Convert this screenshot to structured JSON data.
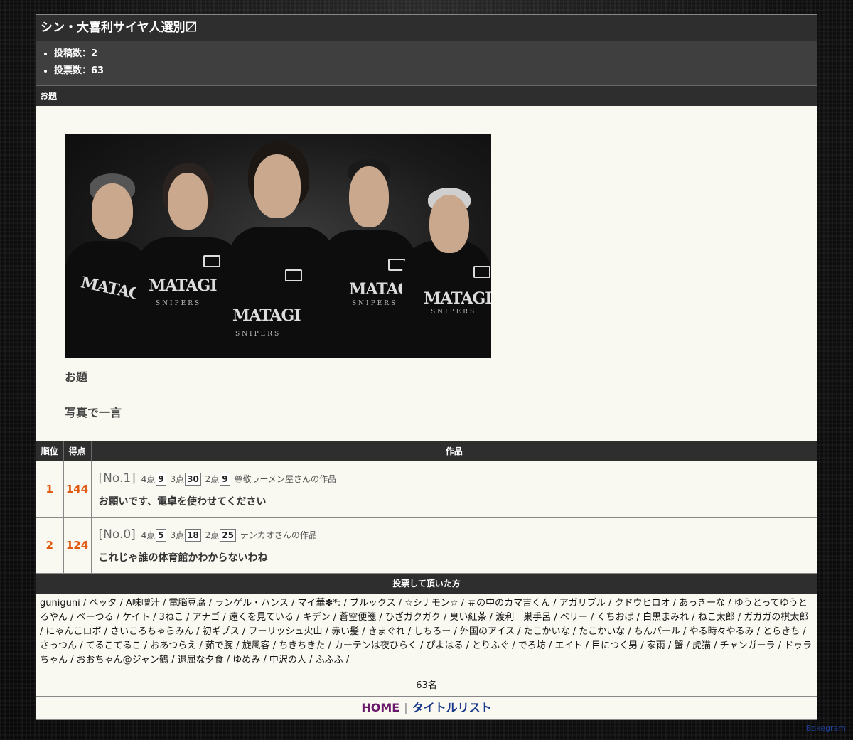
{
  "page": {
    "title": "シン・大喜利サイヤ人選別〼",
    "stats": [
      "投稿数：2",
      "投票数：63"
    ]
  },
  "odai_section": {
    "header": "お題",
    "label": "お題",
    "text": "写真で一言",
    "photo_shirt_text": "MATAGI",
    "photo_shirt_sub": "SNIPERS"
  },
  "results": {
    "headers": {
      "rank": "順位",
      "score": "得点",
      "work": "作品"
    },
    "rows": [
      {
        "rank": "1",
        "score": "144",
        "no": "[No.1]",
        "p4_label": "4点",
        "p4": "9",
        "p3_label": "3点",
        "p3": "30",
        "p2_label": "2点",
        "p2": "9",
        "author": "尊敬ラーメン屋さんの作品",
        "text": "お願いです、電卓を使わせてください"
      },
      {
        "rank": "2",
        "score": "124",
        "no": "[No.0]",
        "p4_label": "4点",
        "p4": "5",
        "p3_label": "3点",
        "p3": "18",
        "p2_label": "2点",
        "p2": "25",
        "author": "テンカオさんの作品",
        "text": "これじゃ誰の体育館かわからないわね"
      }
    ]
  },
  "voters": {
    "header": "投票して頂いた方",
    "list": "guniguni / ペッタ / A味噌汁 / 電脳豆腐 / ランゲル・ハンス / マイ華✽*: / ブルックス / ☆シナモン☆ / ＃の中のカマ吉くん / アガリブル / クドウヒロオ / あっきーな / ゆうとってゆうとるやん / ベーつる / ケイト / 3ねこ / アナゴ / 遠くを見ている / キデン / 蒼空便箋 / ひざガクガク / 臭い紅茶 / 渡利　巣手呂 / ベリー / くちおば / 白黒まみれ / ねこ太郎 / ガガガの棋太郎 / にゃんこロボ / さいころちゃらみん / 初ギプス / フーリッシュ火山 / 赤い髪 / きまぐれ / しちろー / 外国のアイス / たこかいな / たこかいな / ちんパール / やる時々やるみ / とらきち / さっつん / てるこてるこ / おあつらえ / 茹で腕 / 旋風客 / ちきちきた / カーテンは夜ひらく / ぴよはる / とりふぐ / でろ坊 / エイト / 目につく男 / 家雨 / 蟹 / 虎猫 / チャンガーラ / ドゥラちゃん / おおちゃん@ジャン鶴 / 退屈な夕食 / ゆめみ / 中沢の人 / ふふふ /",
    "count": "63名"
  },
  "footer": {
    "home": "HOME",
    "separator": "|",
    "title_list": "タイトルリスト"
  },
  "credit": "Bokegram",
  "colors": {
    "header_bg": "#2e2e2e",
    "stats_bg": "#3f3f3f",
    "panel_bg": "#faf9f1",
    "rank_color": "#e05a10",
    "home_link": "#6a1a6a",
    "list_link": "#1a3a8a"
  }
}
